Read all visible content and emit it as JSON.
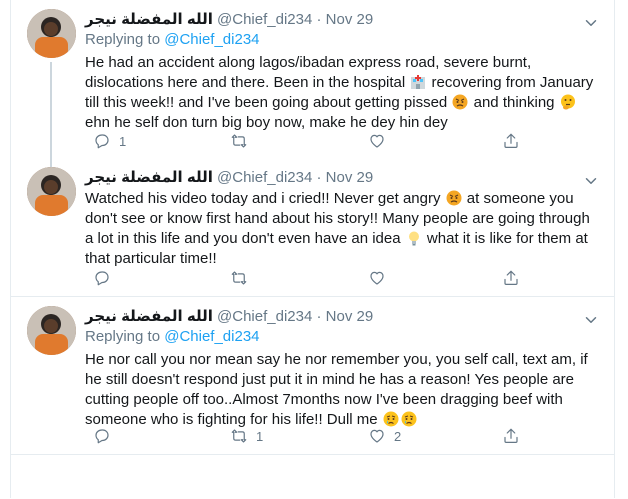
{
  "tweets": [
    {
      "name": "الله المفضلة نيجر",
      "handle": "@Chief_di234",
      "separator": "·",
      "date": "Nov 29",
      "replying_prefix": "Replying to ",
      "replying_handle": "@Chief_di234",
      "text_parts": [
        "He had an accident along lagos/ibadan express road, severe burnt, dislocations here and there. Been in the hospital ",
        " recovering from January till this week!! and I've been going about getting pissed ",
        " and thinking ",
        " ehn he self don turn big boy now, make he dey hin dey"
      ],
      "emojis": [
        "hospital-emoji",
        "angry-face-emoji",
        "thinking-face-emoji"
      ],
      "reply_count": "1",
      "retweet_count": "",
      "like_count": ""
    },
    {
      "name": "الله المفضلة نيجر",
      "handle": "@Chief_di234",
      "separator": "·",
      "date": "Nov 29",
      "text_parts": [
        "Watched his video today and i cried!! Never get angry ",
        " at someone you don't see or know first hand about his story!! Many people are going through a lot in this life and you don't even have an idea ",
        " what it is like for them at that particular time!!"
      ],
      "emojis": [
        "angry-face-emoji",
        "light-bulb-emoji"
      ],
      "reply_count": "",
      "retweet_count": "",
      "like_count": ""
    },
    {
      "name": "الله المفضلة نيجر",
      "handle": "@Chief_di234",
      "separator": "·",
      "date": "Nov 29",
      "replying_prefix": "Replying to ",
      "replying_handle": "@Chief_di234",
      "text_parts": [
        "He nor call you nor mean say he nor remember you, you self call, text am, if he still doesn't respond just put it in mind he has a reason! Yes people are cutting people off too..Almost 7months now I've been dragging beef with someone who is fighting for his life!! Dull me ",
        "",
        ""
      ],
      "emojis": [
        "crying-face-emoji",
        "crying-face-emoji"
      ],
      "reply_count": "",
      "retweet_count": "1",
      "like_count": "2"
    }
  ],
  "colors": {
    "accent": "#1da1f2",
    "secondary_text": "#657786",
    "border": "#e6ecf0"
  }
}
